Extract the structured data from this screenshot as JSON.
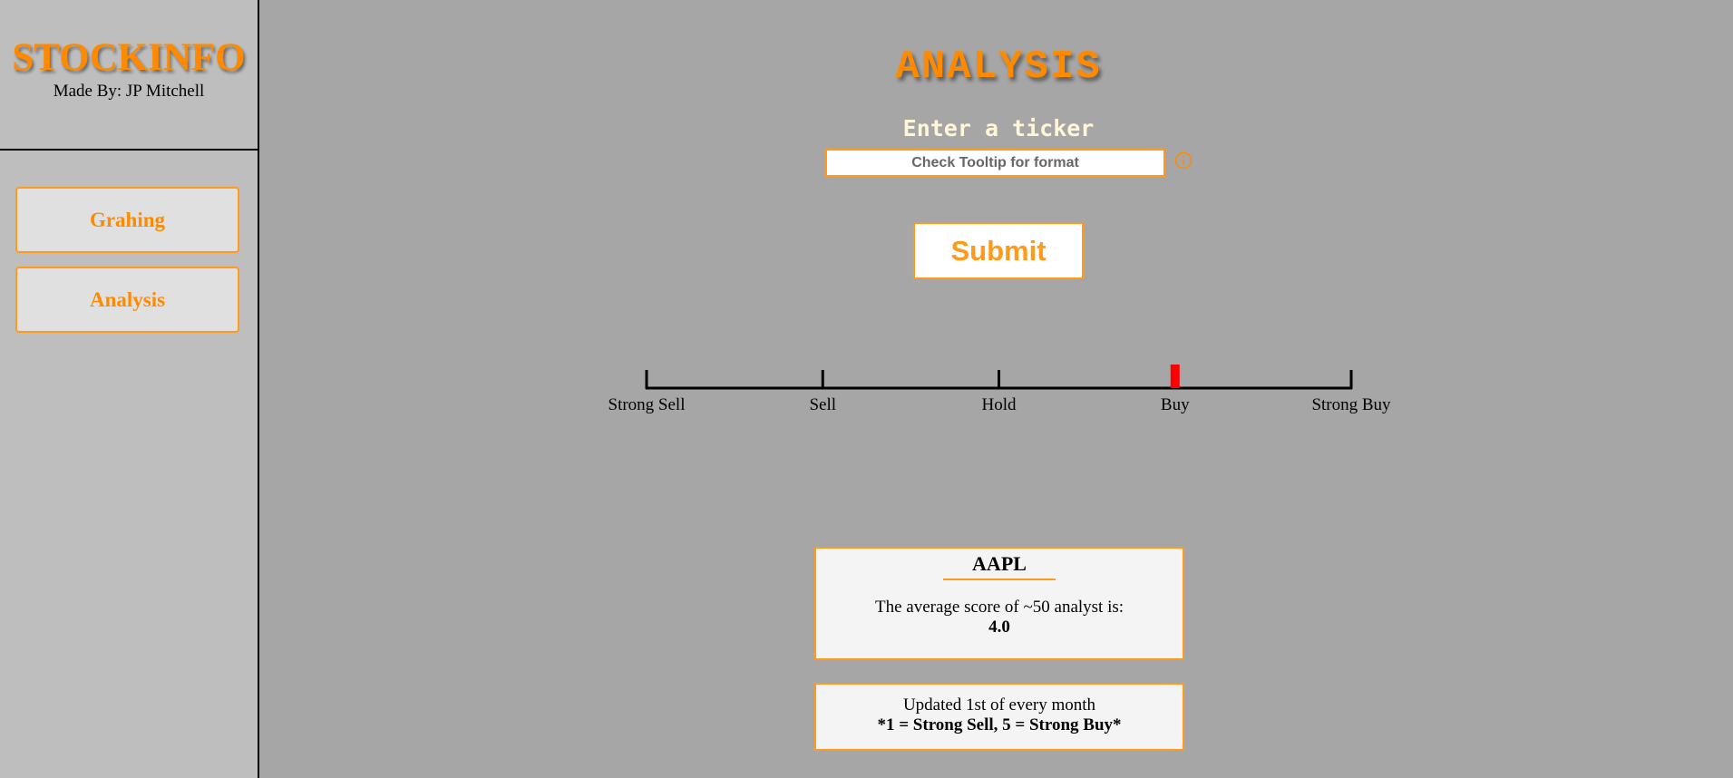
{
  "sidebar": {
    "brand_title": "STOCKINFO",
    "brand_subtitle": "Made By: JP Mitchell",
    "nav": [
      {
        "label": "Grahing"
      },
      {
        "label": "Analysis"
      }
    ]
  },
  "main": {
    "title": "ANALYSIS",
    "ticker_label": "Enter a ticker",
    "ticker_input": {
      "value": "",
      "placeholder": "Check Tooltip for format"
    },
    "info_icon": "info-circle-icon",
    "submit_label": "Submit"
  },
  "rating_scale": {
    "labels": [
      "Strong Sell",
      "Sell",
      "Hold",
      "Buy",
      "Strong Buy"
    ],
    "min": 1,
    "max": 5,
    "value": 4.0,
    "marker_color": "#ff0000"
  },
  "result_card": {
    "ticker": "AAPL",
    "summary_text": "The average score of ~50 analyst is:",
    "score": "4.0"
  },
  "info_card": {
    "line1": "Updated 1st of every month",
    "line2": "*1 = Strong Sell, 5 = Strong Buy*"
  },
  "colors": {
    "accent": "#ff8a00",
    "background": "#a6a6a6",
    "sidebar": "#bebebe"
  }
}
